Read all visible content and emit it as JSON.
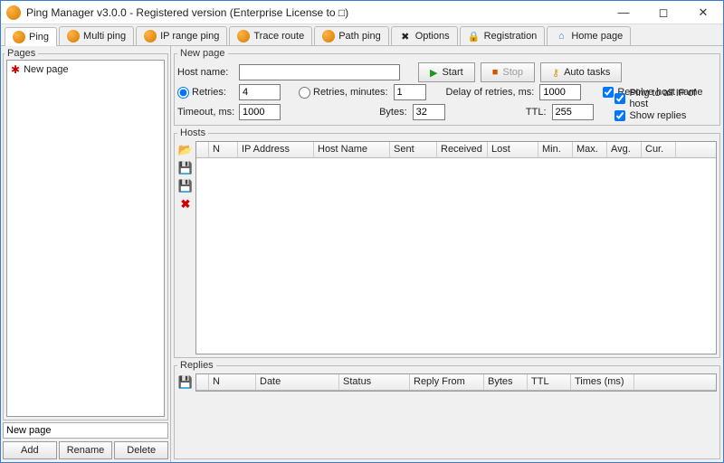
{
  "window": {
    "title": "Ping Manager v3.0.0 - Registered version (Enterprise License to □)"
  },
  "tabs": [
    {
      "label": "Ping",
      "icon": "orange",
      "active": true
    },
    {
      "label": "Multi ping",
      "icon": "orange"
    },
    {
      "label": "IP range ping",
      "icon": "orange"
    },
    {
      "label": "Trace route",
      "icon": "orange"
    },
    {
      "label": "Path ping",
      "icon": "orange"
    },
    {
      "label": "Options",
      "icon": "wrench"
    },
    {
      "label": "Registration",
      "icon": "lock"
    },
    {
      "label": "Home page",
      "icon": "home"
    }
  ],
  "pages": {
    "legend": "Pages",
    "items": [
      {
        "label": "New page"
      }
    ],
    "new_page_value": "New page",
    "buttons": {
      "add": "Add",
      "rename": "Rename",
      "delete": "Delete"
    }
  },
  "newpage": {
    "legend": "New page",
    "hostname_label": "Host name:",
    "hostname_value": "",
    "start": "Start",
    "stop": "Stop",
    "autotasks": "Auto tasks",
    "retries_label": "Retries:",
    "retries_value": "4",
    "retries_min_label": "Retries, minutes:",
    "retries_min_value": "1",
    "delay_label": "Delay of retries, ms:",
    "delay_value": "1000",
    "timeout_label": "Timeout, ms:",
    "timeout_value": "1000",
    "bytes_label": "Bytes:",
    "bytes_value": "32",
    "ttl_label": "TTL:",
    "ttl_value": "255",
    "chk_resolve": "Resolve host name",
    "chk_pingall": "Ping to all IP of host",
    "chk_showreplies": "Show replies"
  },
  "hosts": {
    "legend": "Hosts",
    "columns": [
      "N",
      "IP Address",
      "Host Name",
      "Sent",
      "Received",
      "Lost",
      "Min.",
      "Max.",
      "Avg.",
      "Cur."
    ]
  },
  "replies": {
    "legend": "Replies",
    "columns": [
      "N",
      "Date",
      "Status",
      "Reply From",
      "Bytes",
      "TTL",
      "Times (ms)"
    ]
  }
}
